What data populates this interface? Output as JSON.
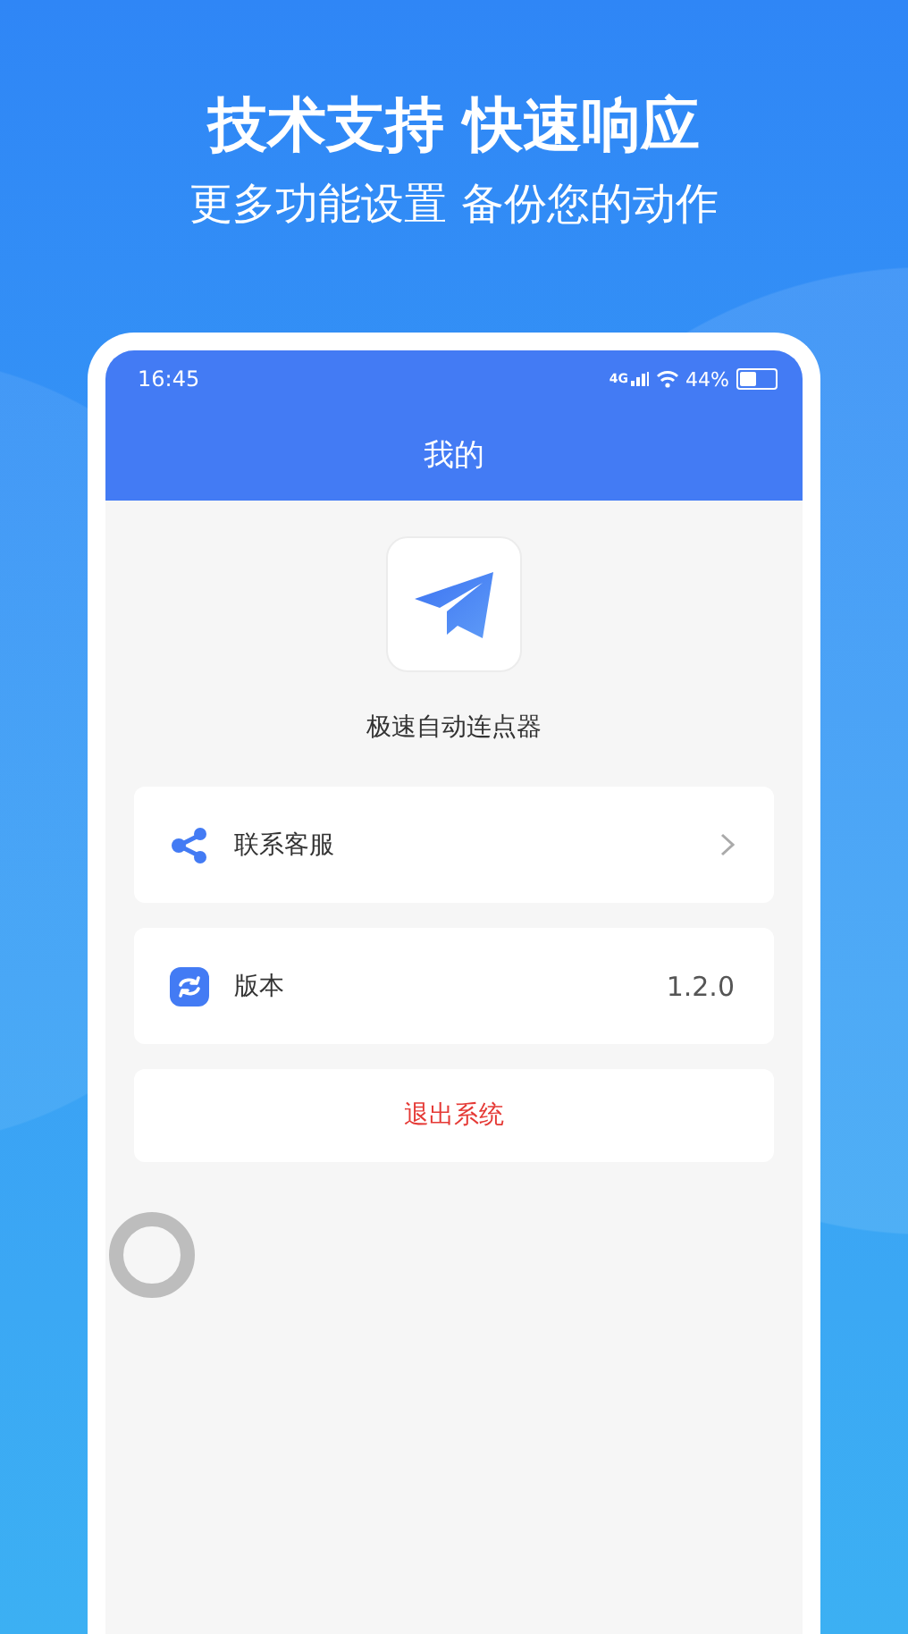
{
  "promo": {
    "headline": "技术支持 快速响应",
    "subtitle": "更多功能设置 备份您的动作"
  },
  "status_bar": {
    "time": "16:45",
    "network": "4G",
    "battery": "44%"
  },
  "header": {
    "title": "我的"
  },
  "app": {
    "name": "极速自动连点器"
  },
  "menu": [
    {
      "kind": "link",
      "label": "联系客服"
    },
    {
      "kind": "info",
      "label": "版本",
      "value": "1.2.0"
    }
  ],
  "logout": {
    "label": "退出系统"
  }
}
